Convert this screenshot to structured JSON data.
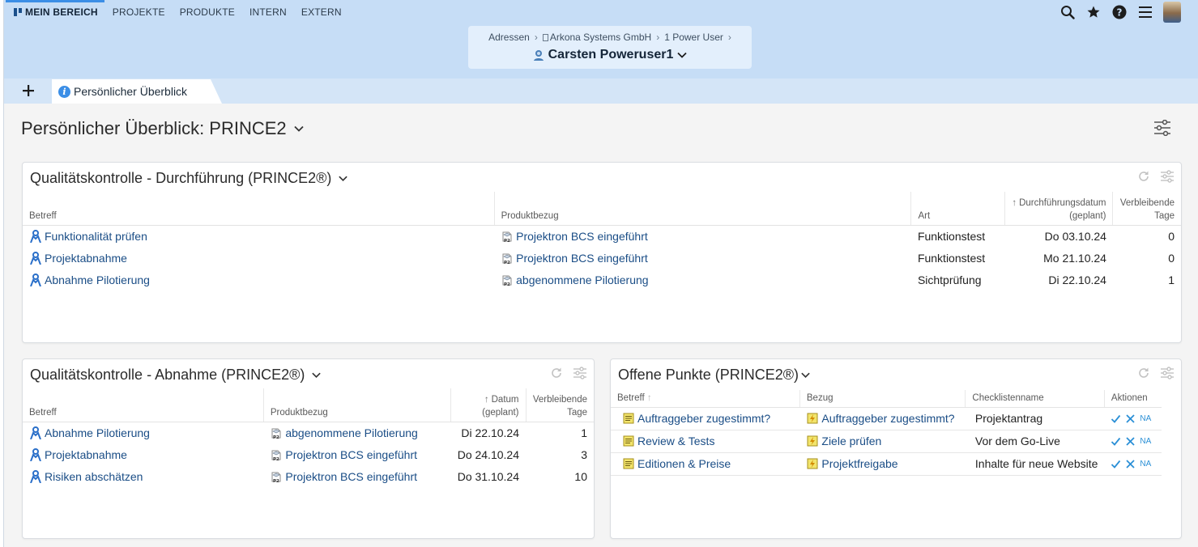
{
  "topnav": {
    "items": [
      {
        "label": "MEIN BEREICH"
      },
      {
        "label": "PROJEKTE"
      },
      {
        "label": "PRODUKTE"
      },
      {
        "label": "INTERN"
      },
      {
        "label": "EXTERN"
      }
    ],
    "icons": [
      "search-icon",
      "star-icon",
      "help-icon",
      "menu-icon",
      "avatar"
    ]
  },
  "breadcrumb": {
    "items": [
      "Adressen",
      "Arkona Systems GmbH",
      "1 Power User"
    ],
    "current": "Carsten Poweruser1"
  },
  "tabs": {
    "add_icon": "plus-icon",
    "active": "Persönlicher Überblick"
  },
  "page": {
    "title": "Persönlicher Überblick: PRINCE2"
  },
  "panel_durchfuehrung": {
    "title": "Qualitätskontrolle - Durchführung (PRINCE2®)",
    "headers": {
      "betreff": "Betreff",
      "produktbezug": "Produktbezug",
      "art": "Art",
      "datum_1": "Durchführungsdatum",
      "datum_2": "(geplant)",
      "tage_1": "Verbleibende",
      "tage_2": "Tage"
    },
    "rows": [
      {
        "betreff": "Funktionalität prüfen",
        "produkt": "Projektron BCS eingeführt",
        "art": "Funktionstest",
        "datum": "Do 03.10.24",
        "tage": "0"
      },
      {
        "betreff": "Projektabnahme",
        "produkt": "Projektron BCS eingeführt",
        "art": "Funktionstest",
        "datum": "Mo 21.10.24",
        "tage": "0"
      },
      {
        "betreff": "Abnahme Pilotierung",
        "produkt": "abgenommene Pilotierung",
        "art": "Sichtprüfung",
        "datum": "Di 22.10.24",
        "tage": "1"
      }
    ]
  },
  "panel_abnahme": {
    "title": "Qualitätskontrolle - Abnahme (PRINCE2®)",
    "headers": {
      "betreff": "Betreff",
      "produktbezug": "Produktbezug",
      "datum_1": "Datum",
      "datum_2": "(geplant)",
      "tage_1": "Verbleibende",
      "tage_2": "Tage"
    },
    "rows": [
      {
        "betreff": "Abnahme Pilotierung",
        "produkt": "abgenommene Pilotierung",
        "datum": "Di 22.10.24",
        "tage": "1"
      },
      {
        "betreff": "Projektabnahme",
        "produkt": "Projektron BCS eingeführt",
        "datum": "Do 24.10.24",
        "tage": "3"
      },
      {
        "betreff": "Risiken abschätzen",
        "produkt": "Projektron BCS eingeführt",
        "datum": "Do 31.10.24",
        "tage": "10"
      }
    ]
  },
  "panel_offene": {
    "title": "Offene Punkte (PRINCE2®)",
    "headers": {
      "betreff": "Betreff",
      "bezug": "Bezug",
      "checkliste": "Checklistenname",
      "aktionen": "Aktionen"
    },
    "rows": [
      {
        "betreff": "Auftraggeber zugestimmt?",
        "bezug": "Auftraggeber zugestimmt?",
        "checkliste": "Projektantrag",
        "na": "NA"
      },
      {
        "betreff": "Review & Tests",
        "bezug": "Ziele prüfen",
        "checkliste": "Vor dem Go-Live",
        "na": "NA"
      },
      {
        "betreff": "Editionen & Preise",
        "bezug": "Projektfreigabe",
        "checkliste": "Inhalte für neue Website",
        "na": "NA"
      }
    ]
  },
  "colors": {
    "header_bg": "#c6ddf6",
    "link": "#1a4d86",
    "accent": "#3b8ee6",
    "action_teal": "#2a8fd6",
    "note_yellow": "#f2e46b"
  }
}
